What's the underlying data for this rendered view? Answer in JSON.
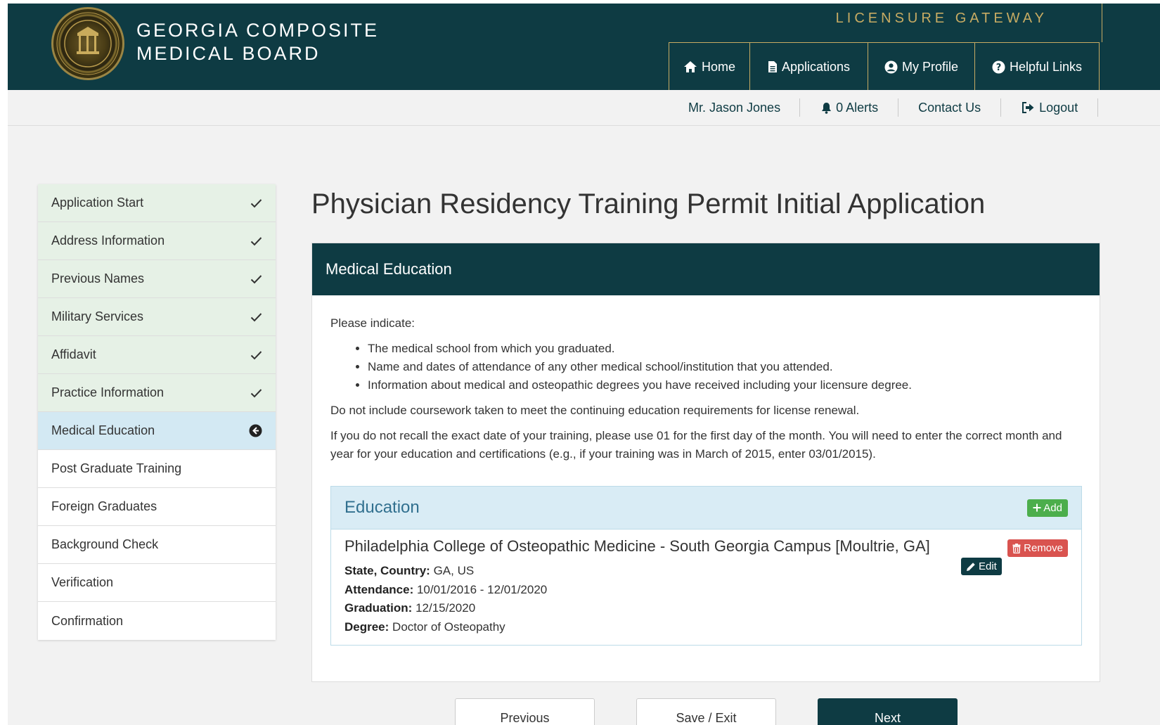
{
  "header": {
    "brand_line1": "GEORGIA COMPOSITE",
    "brand_line2": "MEDICAL BOARD",
    "gateway": "LICENSURE GATEWAY",
    "nav": [
      {
        "label": "Home",
        "icon": "home-icon"
      },
      {
        "label": "Applications",
        "icon": "document-icon"
      },
      {
        "label": "My Profile",
        "icon": "user-circle-icon"
      },
      {
        "label": "Helpful Links",
        "icon": "question-circle-icon"
      }
    ]
  },
  "subnav": {
    "user": "Mr. Jason Jones",
    "alerts": "0 Alerts",
    "contact": "Contact Us",
    "logout": "Logout"
  },
  "sidebar": {
    "items": [
      {
        "label": "Application Start",
        "status": "done"
      },
      {
        "label": "Address Information",
        "status": "done"
      },
      {
        "label": "Previous Names",
        "status": "done"
      },
      {
        "label": "Military Services",
        "status": "done"
      },
      {
        "label": "Affidavit",
        "status": "done"
      },
      {
        "label": "Practice Information",
        "status": "done"
      },
      {
        "label": "Medical Education",
        "status": "active"
      },
      {
        "label": "Post Graduate Training",
        "status": "pending"
      },
      {
        "label": "Foreign Graduates",
        "status": "pending"
      },
      {
        "label": "Background Check",
        "status": "pending"
      },
      {
        "label": "Verification",
        "status": "pending"
      },
      {
        "label": "Confirmation",
        "status": "pending"
      }
    ]
  },
  "main": {
    "title": "Physician Residency Training Permit Initial Application",
    "panel_title": "Medical Education",
    "intro": "Please indicate:",
    "bullets": [
      "The medical school from which you graduated.",
      "Name and dates of attendance of any other medical school/institution that you attended.",
      "Information about medical and osteopathic degrees you have received including your licensure degree."
    ],
    "note1": "Do not include coursework taken to meet the continuing education requirements for license renewal.",
    "note2": "If you do not recall the exact date of your training, please use 01 for the first day of the month. You will need to enter the correct month and year for your education and certifications (e.g., if your training was in March of 2015, enter 03/01/2015).",
    "education": {
      "title": "Education",
      "add_label": "Add",
      "remove_label": "Remove",
      "edit_label": "Edit",
      "school": "Philadelphia College of Osteopathic Medicine - South Georgia Campus [Moultrie, GA]",
      "state_label": "State, Country:",
      "state_value": "GA, US",
      "attendance_label": "Attendance:",
      "attendance_value": "10/01/2016 - 12/01/2020",
      "graduation_label": "Graduation:",
      "graduation_value": "12/15/2020",
      "degree_label": "Degree:",
      "degree_value": "Doctor of Osteopathy"
    }
  },
  "footer": {
    "previous": "Previous",
    "save_exit": "Save / Exit",
    "next": "Next"
  },
  "colors": {
    "primary": "#0e3b43",
    "gold": "#c7ab63",
    "done_bg": "#e6f1e6",
    "active_bg": "#d3e9f3"
  }
}
